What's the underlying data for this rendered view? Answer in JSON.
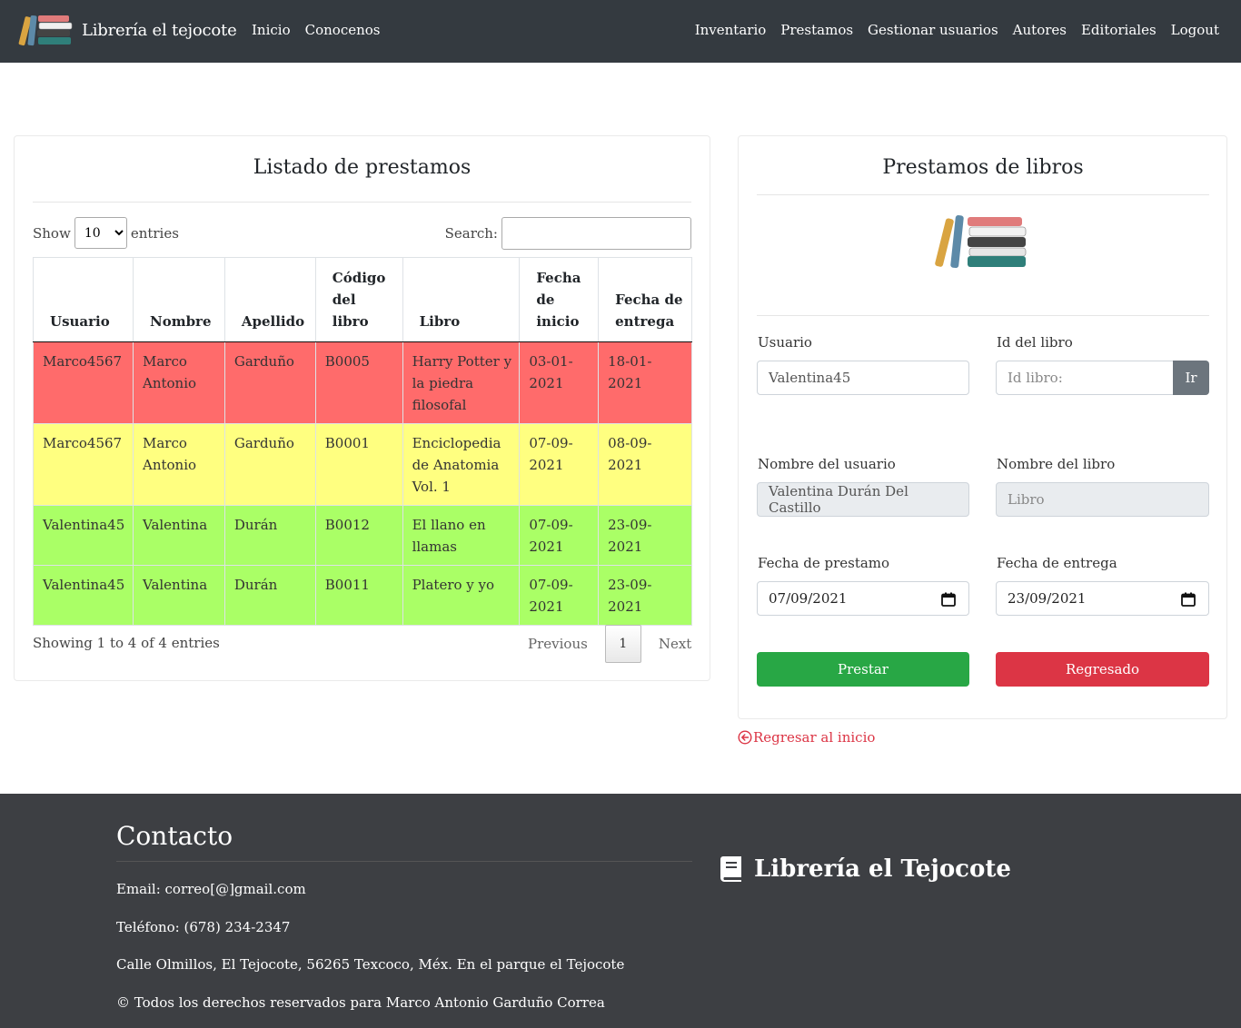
{
  "nav": {
    "brand": "Librería el tejocote",
    "left_links": [
      "Inicio",
      "Conocenos"
    ],
    "right_links": [
      "Inventario",
      "Prestamos",
      "Gestionar usuarios",
      "Autores",
      "Editoriales",
      "Logout"
    ]
  },
  "loans_table": {
    "title": "Listado de prestamos",
    "show_label": "Show",
    "entries_label": "entries",
    "page_length": "10",
    "search_label": "Search:",
    "columns": [
      "Usuario",
      "Nombre",
      "Apellido",
      "Código del libro",
      "Libro",
      "Fecha de inicio",
      "Fecha de entrega"
    ],
    "rows": [
      {
        "status": "red",
        "cells": [
          "Marco4567",
          "Marco Antonio",
          "Garduño",
          "B0005",
          "Harry Potter y la piedra filosofal",
          "03-01-2021",
          "18-01-2021"
        ]
      },
      {
        "status": "yellow",
        "cells": [
          "Marco4567",
          "Marco Antonio",
          "Garduño",
          "B0001",
          "Enciclopedia de Anatomia Vol. 1",
          "07-09-2021",
          "08-09-2021"
        ]
      },
      {
        "status": "green",
        "cells": [
          "Valentina45",
          "Valentina",
          "Durán",
          "B0012",
          "El llano en llamas",
          "07-09-2021",
          "23-09-2021"
        ]
      },
      {
        "status": "green",
        "cells": [
          "Valentina45",
          "Valentina",
          "Durán",
          "B0011",
          "Platero y yo",
          "07-09-2021",
          "23-09-2021"
        ]
      }
    ],
    "info": "Showing 1 to 4 of 4 entries",
    "previous": "Previous",
    "current_page": "1",
    "next": "Next",
    "row_colors": {
      "red": "#ff6b6b",
      "yellow": "#ffff80",
      "green": "#aaff66"
    }
  },
  "loan_form": {
    "title": "Prestamos de libros",
    "user_label": "Usuario",
    "user_value": "Valentina45",
    "book_id_label": "Id del libro",
    "book_id_placeholder": "Id libro:",
    "go_button": "Ir",
    "user_name_label": "Nombre del usuario",
    "user_name_value": "Valentina Durán Del Castillo",
    "book_name_label": "Nombre del libro",
    "book_name_placeholder": "Libro",
    "loan_date_label": "Fecha de prestamo",
    "loan_date_value": "07/09/2021",
    "return_date_label": "Fecha de entrega",
    "return_date_value": "23/09/2021",
    "lend_button": "Prestar",
    "returned_button": "Regresado"
  },
  "back_link": "Regresar al inicio",
  "footer": {
    "heading": "Contacto",
    "email": "Email: correo[@]gmail.com",
    "phone": "Teléfono: (678) 234-2347",
    "address": "Calle Olmillos, El Tejocote, 56265 Texcoco, Méx. En el parque el Tejocote",
    "copyright": "© Todos los derechos reservados para Marco Antonio Garduño Correa",
    "brand": "Librería el Tejocote"
  },
  "colors": {
    "navbar": "#343a40",
    "footer": "#3d3f43",
    "success": "#28a745",
    "danger": "#dc3545",
    "secondary": "#6c757d"
  },
  "icons": [
    "books-logo-icon",
    "calendar-icon",
    "arrow-circle-left-icon",
    "book-icon"
  ]
}
